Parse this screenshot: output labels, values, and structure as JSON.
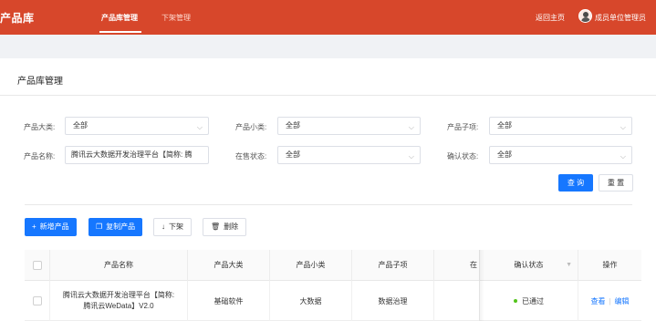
{
  "header": {
    "logo": "产品库",
    "nav": [
      {
        "label": "产品库管理",
        "active": true
      },
      {
        "label": "下架管理",
        "active": false
      }
    ],
    "home_link": "返回主页",
    "user_name": "成员单位管理员"
  },
  "page": {
    "title": "产品库管理"
  },
  "filters": {
    "category_label": "产品大类:",
    "category_value": "全部",
    "subcategory_label": "产品小类:",
    "subcategory_value": "全部",
    "subitem_label": "产品子项:",
    "subitem_value": "全部",
    "name_label": "产品名称:",
    "name_value": "腾讯云大数据开发治理平台【简称: 腾",
    "listing_label": "在售状态:",
    "listing_value": "全部",
    "confirm_label": "确认状态:",
    "confirm_value": "全部",
    "query_button": "查 询",
    "reset_button": "重 置"
  },
  "actions": {
    "add": "新增产品",
    "copy": "复制产品",
    "delist": "下架",
    "delete": "删除"
  },
  "table": {
    "columns": [
      "产品名称",
      "产品大类",
      "产品小类",
      "产品子项",
      "在",
      "确认状态",
      "操作"
    ],
    "rows": [
      {
        "name": "腾讯云大数据开发治理平台【简称: 腾讯云WeData】V2.0",
        "category": "基础软件",
        "subcategory": "大数据",
        "subitem": "数据治理",
        "status": "已通过",
        "op_view": "查看",
        "op_edit": "编辑"
      }
    ]
  },
  "colors": {
    "header_bg": "#d7472b",
    "primary": "#1677ff",
    "status_ok": "#52c41a"
  }
}
